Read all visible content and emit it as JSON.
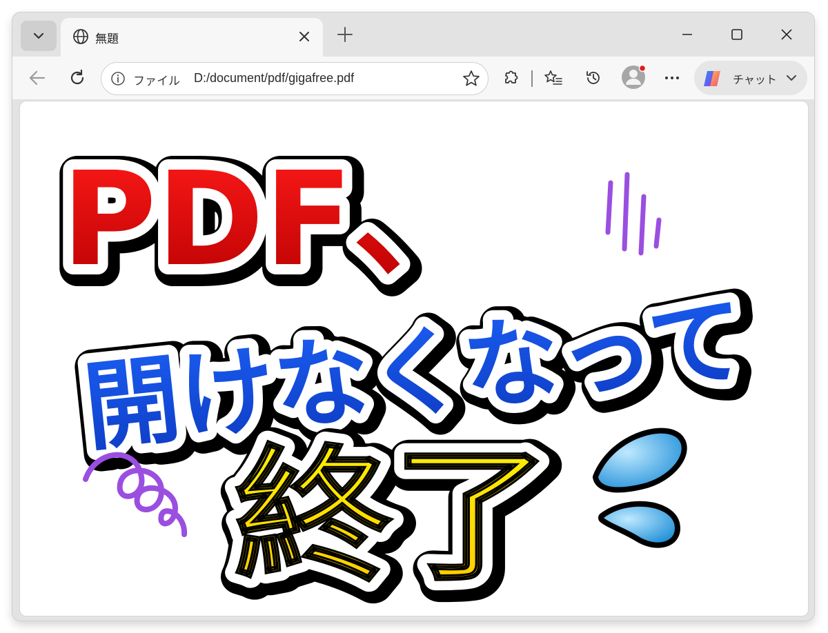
{
  "tab": {
    "title": "無題"
  },
  "address_bar": {
    "scheme_label": "ファイル",
    "url": "D:/document/pdf/gigafree.pdf"
  },
  "copilot": {
    "label": "チャット"
  },
  "artwork": {
    "line1": "PDF、",
    "line2": "開けなくなって",
    "line3": "終了",
    "colors": {
      "line1": "#d90000",
      "line2": "#1448d8",
      "line3": "#ffe000",
      "doodle": "#9a4fe0",
      "drop": "#3aa6e8"
    }
  },
  "icons": [
    "tab-list-icon",
    "globe-icon",
    "close-icon",
    "plus-icon",
    "minimize-icon",
    "maximize-icon",
    "window-close-icon",
    "back-icon",
    "refresh-icon",
    "info-icon",
    "star-icon",
    "extensions-icon",
    "favorites-icon",
    "history-icon",
    "profile-icon",
    "more-icon",
    "copilot-icon",
    "chevron-down-icon"
  ]
}
